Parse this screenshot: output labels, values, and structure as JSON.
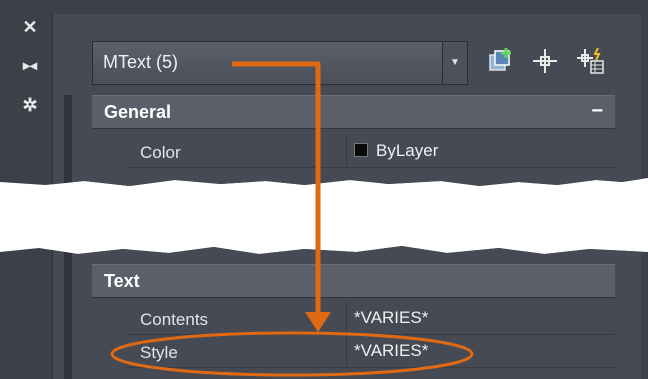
{
  "side_toolbar": {
    "close_icon": "close-icon",
    "autohide_icon": "auto-hide-icon",
    "settings_icon": "gear-icon"
  },
  "selector": {
    "value": "MText (5)"
  },
  "toolbar_icons": [
    "quick-select-icon",
    "select-objects-icon",
    "toggle-pickadd-icon"
  ],
  "sections": {
    "general": {
      "title": "General",
      "toggle": "−",
      "rows": [
        {
          "name": "Color",
          "value": "ByLayer",
          "swatch_color": "#000000"
        }
      ]
    },
    "text": {
      "title": "Text",
      "rows": [
        {
          "name": "Contents",
          "value": "*VARIES*"
        },
        {
          "name": "Style",
          "value": "*VARIES*"
        }
      ]
    }
  },
  "colors": {
    "annotation": "#e06a14",
    "panel_bg": "#3c4049",
    "category_bg": "#5a5f69"
  }
}
